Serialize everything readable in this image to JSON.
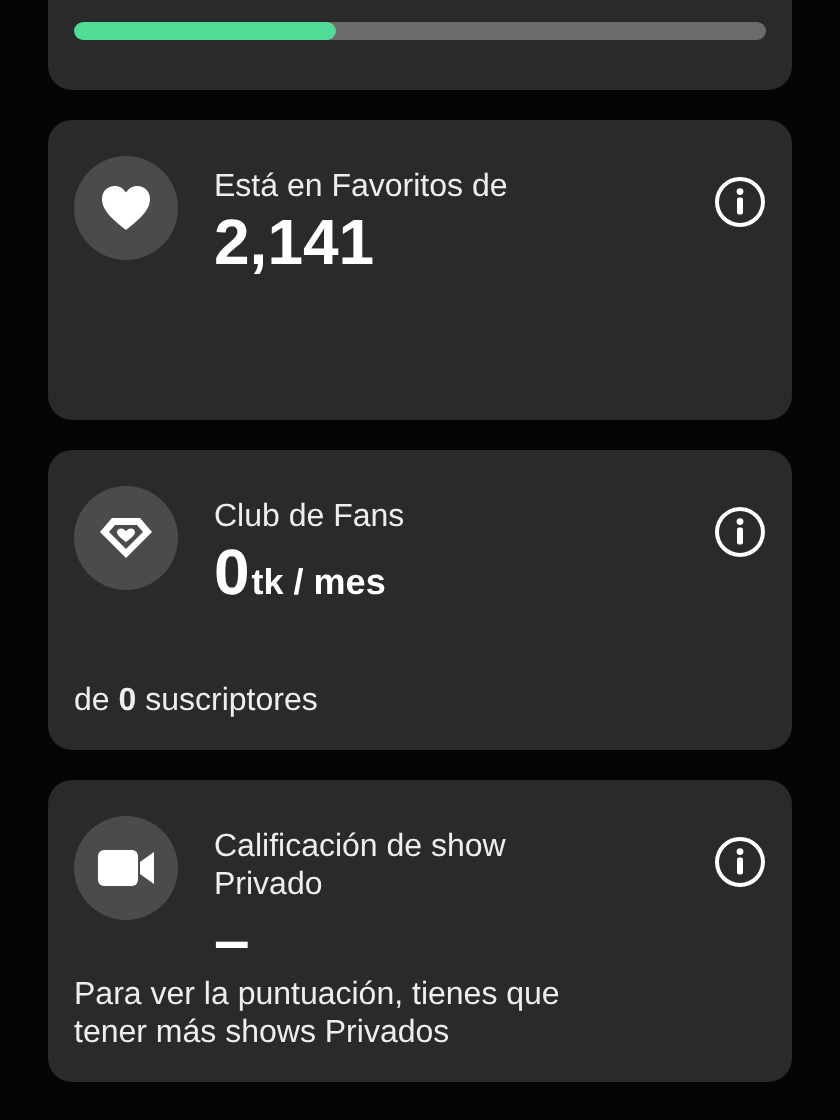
{
  "top_card": {
    "progress": {
      "level": 0.38
    }
  },
  "stat_cards": [
    {
      "kind": "heart",
      "title": "Está en Favoritos de",
      "value": "2,141"
    },
    {
      "kind": "diamond",
      "title": "Club de Fans",
      "value": "0",
      "unit": "tk / mes",
      "footer": "de **0** suscriptores"
    },
    {
      "kind": "camera",
      "title": "Calificación de show Privado",
      "value": "–",
      "footer": "Para ver la puntuación, tienes que tener más shows Privados"
    }
  ]
}
